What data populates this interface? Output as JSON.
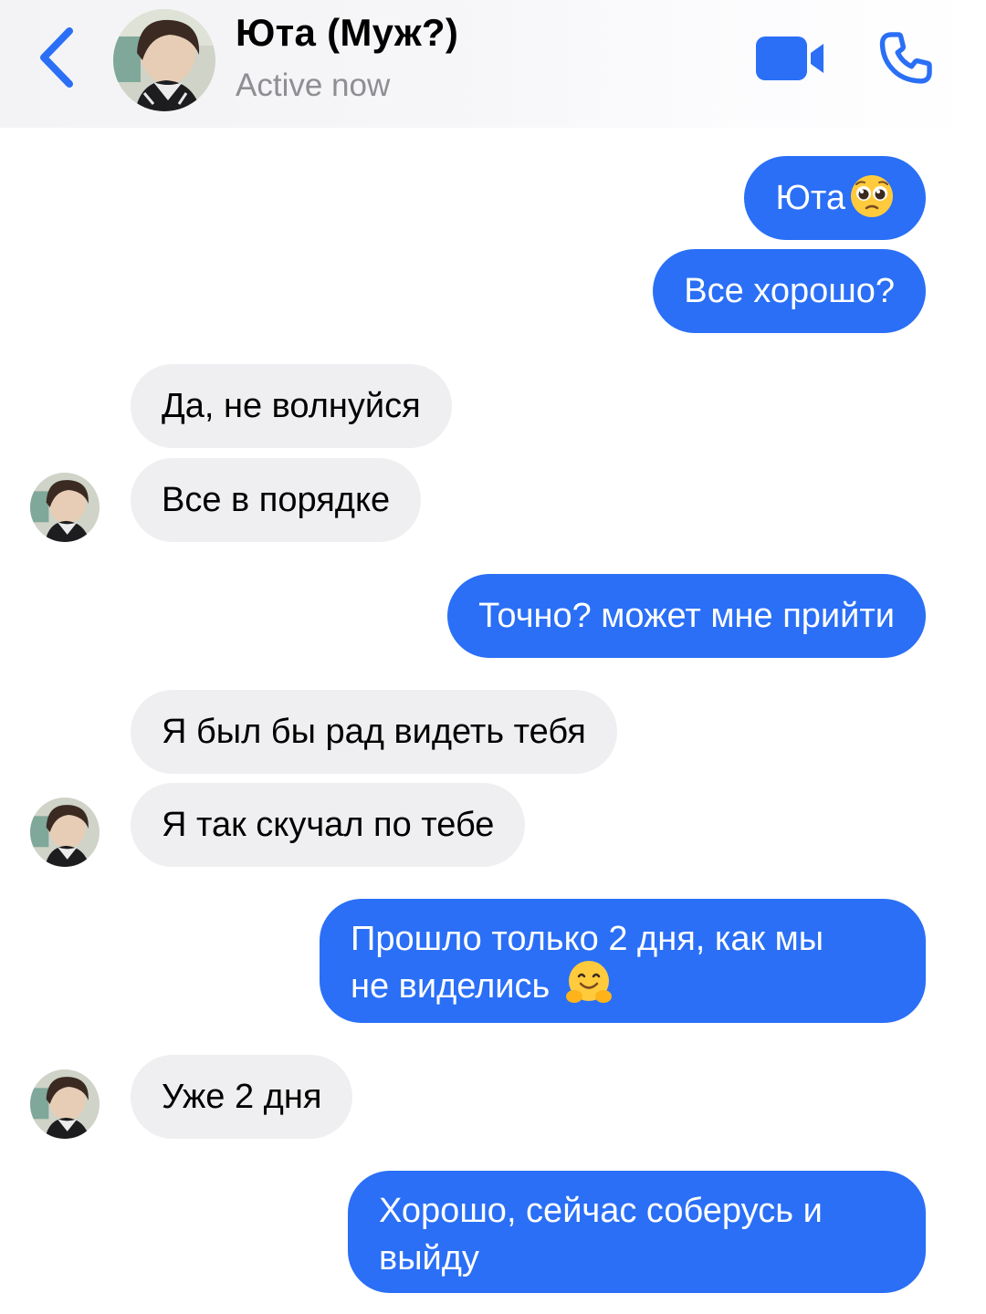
{
  "header": {
    "name": "Юта (Муж?)",
    "status": "Active now",
    "back_icon": "chevron-left-icon",
    "video_icon": "video-camera-icon",
    "call_icon": "phone-icon",
    "accent_color": "#2a6ff6"
  },
  "messages": [
    {
      "side": "outgoing",
      "text": "Юта",
      "emoji": "pleading-face-emoji"
    },
    {
      "side": "outgoing",
      "text": "Все хорошо?"
    },
    {
      "side": "incoming",
      "text": "Да, не волнуйся"
    },
    {
      "side": "incoming",
      "text": "Все в порядке"
    },
    {
      "side": "outgoing",
      "text": "Точно? может мне прийти"
    },
    {
      "side": "incoming",
      "text": "Я был бы рад видеть тебя"
    },
    {
      "side": "incoming",
      "text": "Я так скучал по тебе"
    },
    {
      "side": "outgoing",
      "text_line1": "Прошло только 2 дня, как мы",
      "text_line2": "не виделись",
      "emoji": "hugging-face-emoji"
    },
    {
      "side": "incoming",
      "text": "Уже 2 дня"
    },
    {
      "side": "outgoing",
      "text_line1": "Хорошо, сейчас соберусь и",
      "text_line2": "выйду"
    }
  ]
}
